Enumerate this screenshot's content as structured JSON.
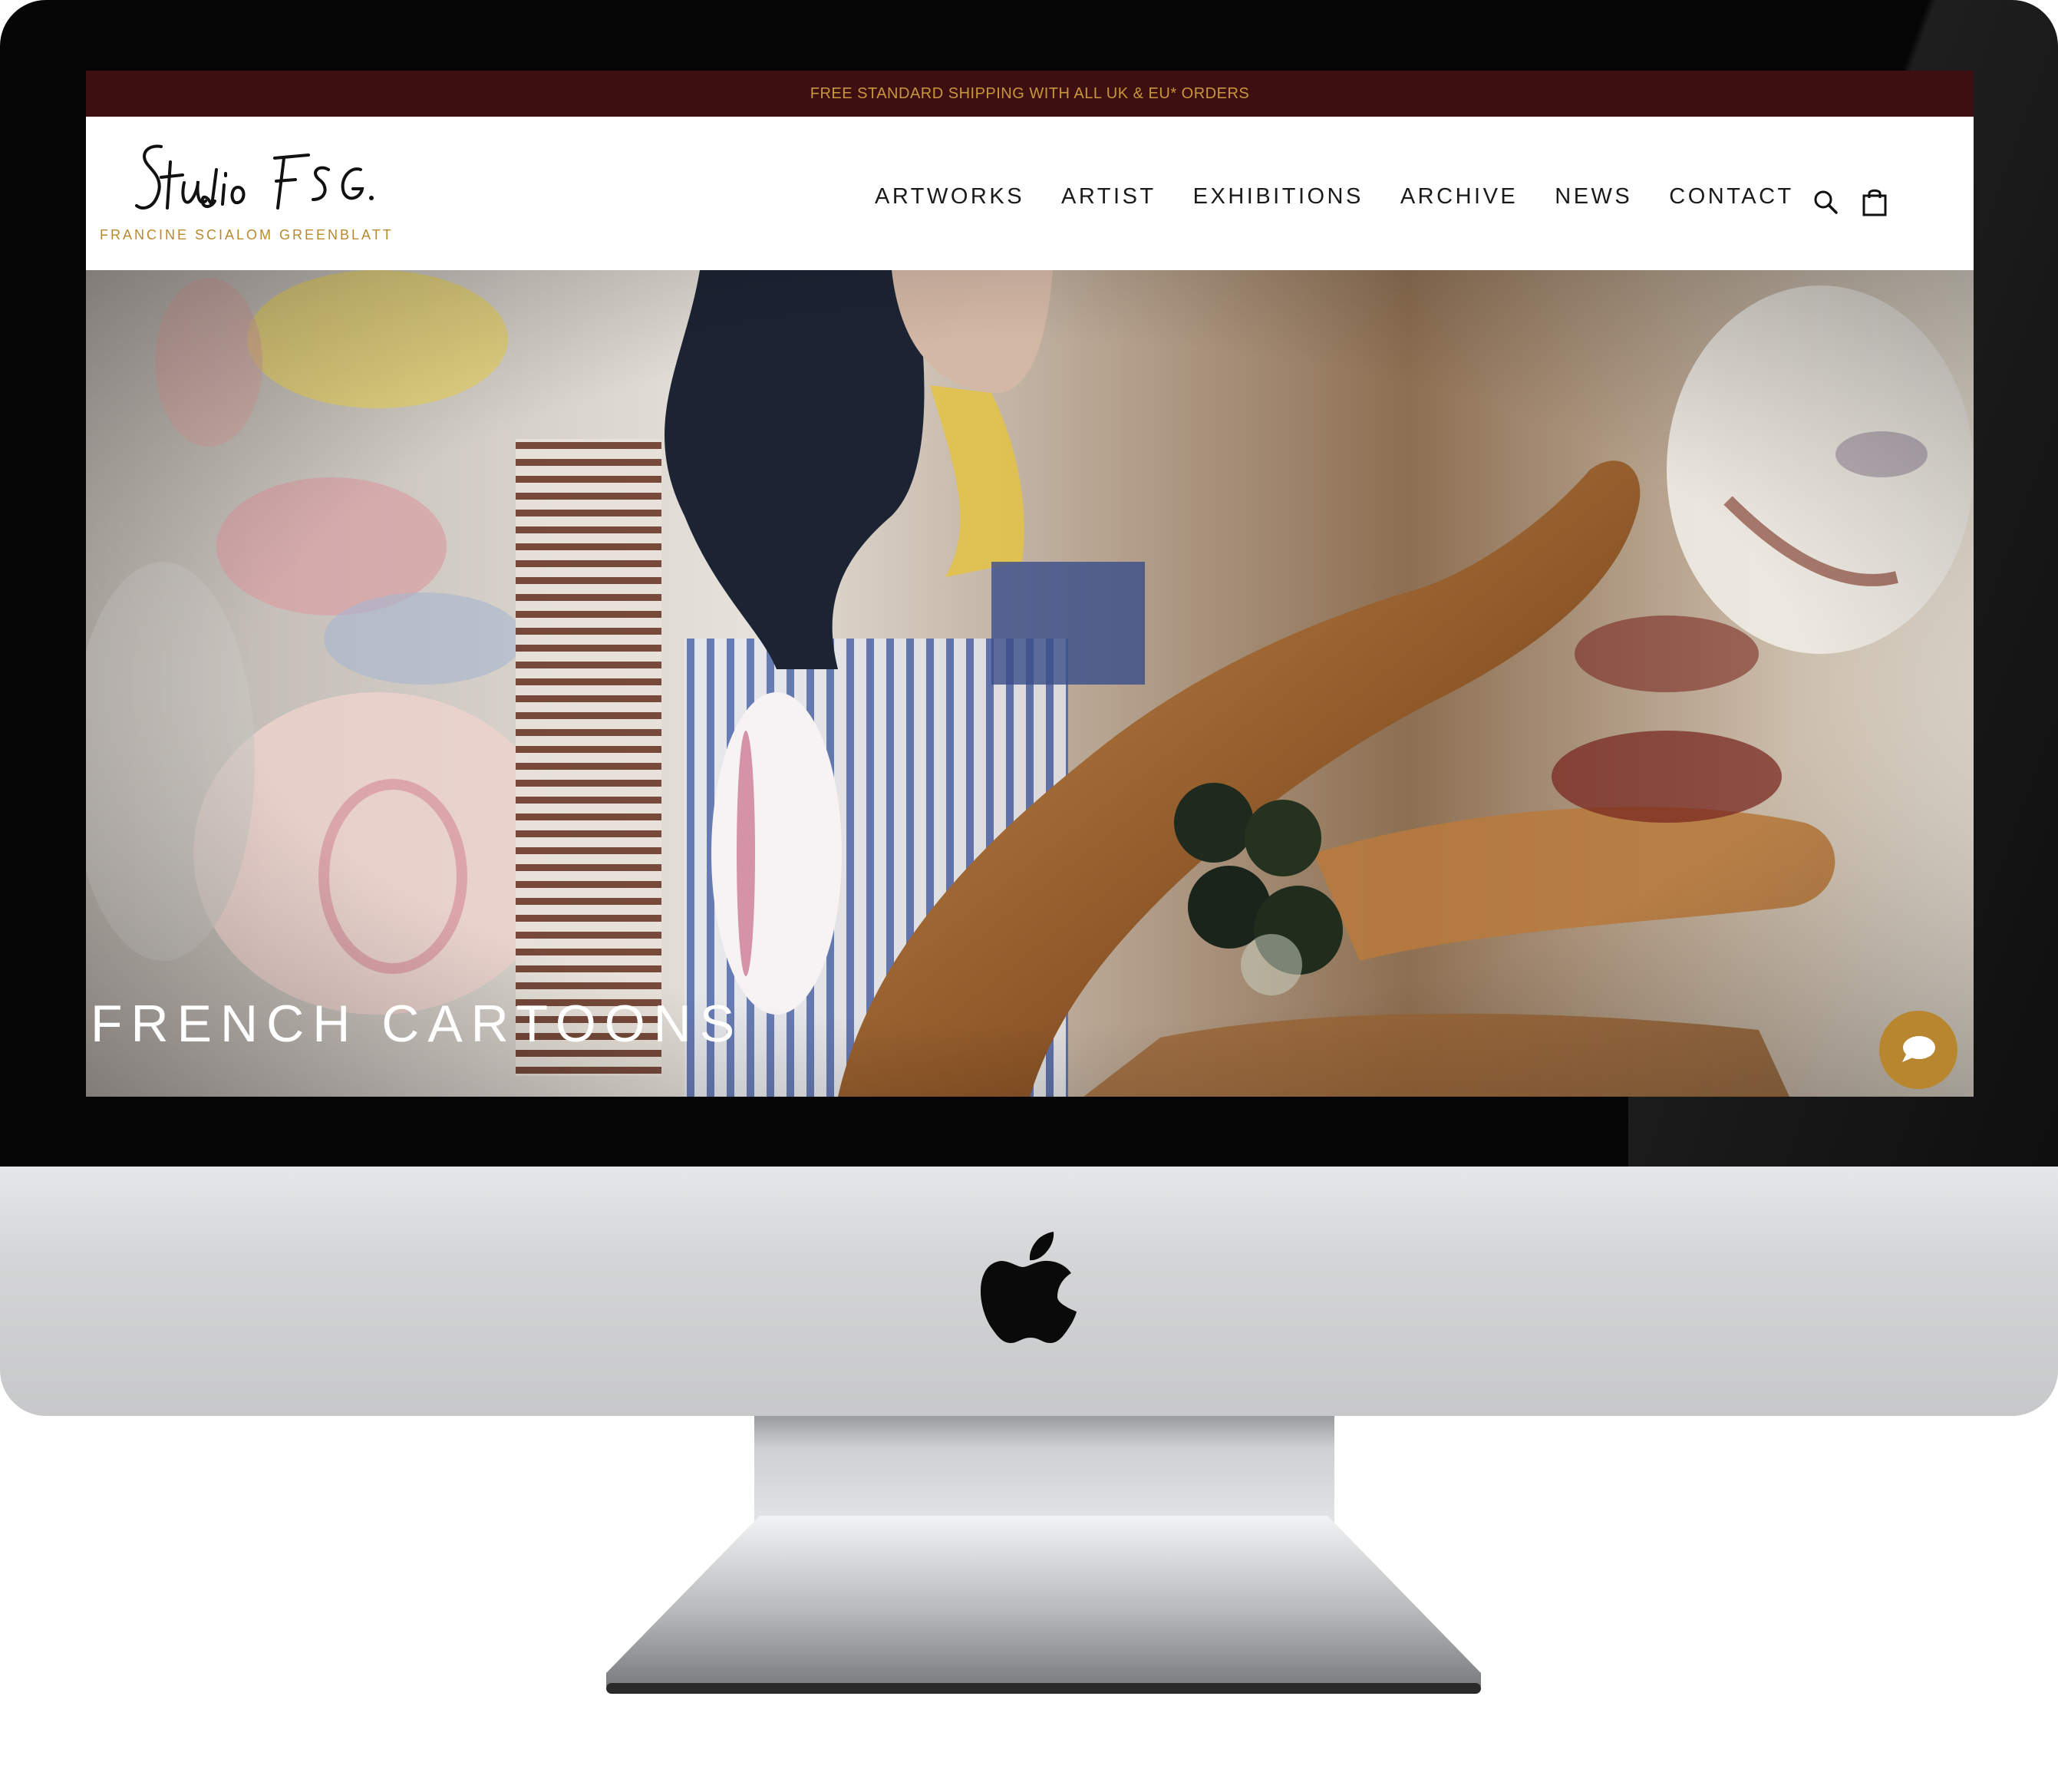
{
  "announcement": {
    "text": "FREE STANDARD SHIPPING WITH ALL UK & EU* ORDERS"
  },
  "header": {
    "logo_alt": "Studio FSG.",
    "logo_subtitle": "FRANCINE SCIALOM GREENBLATT",
    "nav": [
      "ARTWORKS",
      "ARTIST",
      "EXHIBITIONS",
      "ARCHIVE",
      "NEWS",
      "CONTACT"
    ],
    "icons": [
      "search-icon",
      "shopping-bag-icon"
    ]
  },
  "hero": {
    "title": "FRENCH CARTOONS",
    "chat_icon": "chat-bubble-icon"
  },
  "colors": {
    "announcement_bg": "#3d0f10",
    "announcement_text": "#c8963e",
    "logo_subtitle": "#b8892f",
    "chat_button": "#b8862e"
  }
}
